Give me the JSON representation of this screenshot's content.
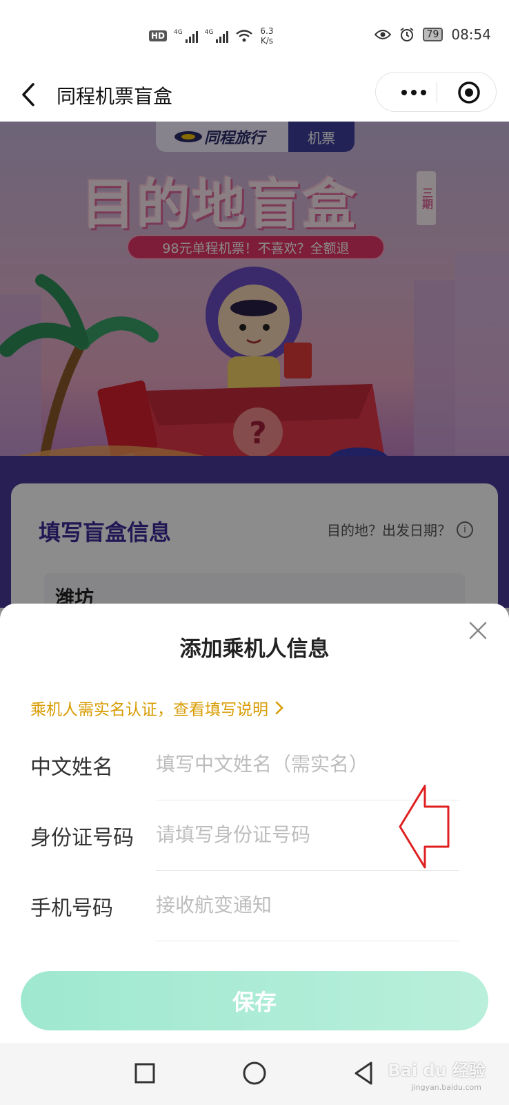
{
  "status_bar": {
    "hd_badge": "HD",
    "network_1": "4G",
    "network_2": "4G",
    "speed_value": "6.3",
    "speed_unit": "K/s",
    "battery": "79",
    "time": "08:54"
  },
  "title_bar": {
    "title": "同程机票盲盒"
  },
  "banner": {
    "brand": "同程旅行",
    "category": "机票",
    "title": "目的地盲盒",
    "period": "三期",
    "tagline": "98元单程机票！不喜欢？全额退"
  },
  "card": {
    "title": "填写盲盒信息",
    "hint": "目的地？出发日期？",
    "city_value": "潍坊"
  },
  "sheet": {
    "title": "添加乘机人信息",
    "notice": "乘机人需实名认证，查看填写说明",
    "fields": [
      {
        "label": "中文姓名",
        "placeholder": "填写中文姓名（需实名）",
        "value": ""
      },
      {
        "label": "身份证号码",
        "placeholder": "请填写身份证号码",
        "value": ""
      },
      {
        "label": "手机号码",
        "placeholder": "接收航变通知",
        "value": ""
      }
    ],
    "save_label": "保存"
  },
  "watermark": {
    "text": "Bai du 经验",
    "sub": "jingyan.baidu.com"
  },
  "colors": {
    "notice": "#d89b00",
    "save_button": "#a8ebd4",
    "card_title": "#3b2a99",
    "annotation_arrow": "#e02020"
  },
  "icons": [
    "back-arrow-icon",
    "more-dots-icon",
    "close-miniprogram-icon",
    "info-icon",
    "close-icon",
    "chevron-right-icon",
    "nav-square-icon",
    "nav-circle-icon",
    "nav-back-triangle-icon"
  ]
}
